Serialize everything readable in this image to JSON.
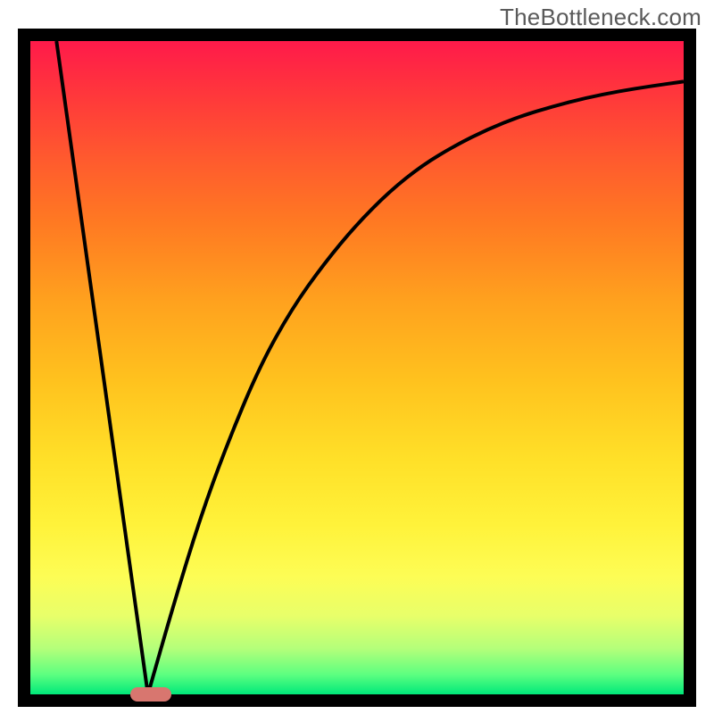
{
  "watermark": "TheBottleneck.com",
  "colors": {
    "frame": "#000000",
    "marker": "#d8766f",
    "watermark": "#5a5a5a",
    "gradient_top": "#ff1a4a",
    "gradient_bottom": "#00e87a"
  },
  "chart_data": {
    "type": "line",
    "title": "",
    "xlabel": "",
    "ylabel": "",
    "xlim": [
      0,
      100
    ],
    "ylim": [
      0,
      100
    ],
    "note": "V-shaped bottleneck-percentage curve with minimum at the marker. Left branch is linear from top-left to the trough; right branch rises with diminishing slope toward upper-right.",
    "series": [
      {
        "name": "left-branch",
        "x": [
          4,
          18
        ],
        "values": [
          100,
          0
        ]
      },
      {
        "name": "right-branch",
        "x": [
          18,
          22,
          26,
          30,
          35,
          40,
          45,
          50,
          55,
          60,
          65,
          70,
          75,
          80,
          85,
          90,
          95,
          100
        ],
        "values": [
          0,
          14,
          27,
          38,
          50,
          59,
          66,
          72,
          77,
          81,
          84,
          86.5,
          88.5,
          90,
          91.3,
          92.3,
          93.1,
          93.8
        ]
      }
    ],
    "marker": {
      "x": 18.5,
      "y": 0,
      "shape": "rounded-rect",
      "color": "#d8766f"
    }
  }
}
